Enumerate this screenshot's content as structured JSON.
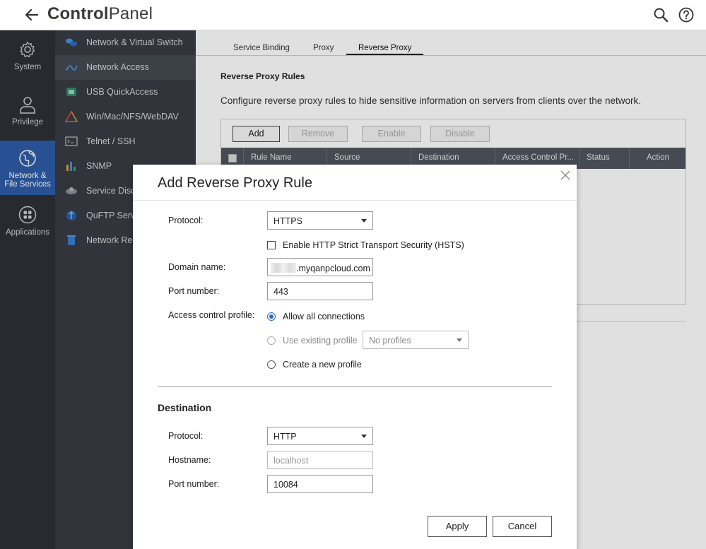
{
  "app": {
    "title_bold": "Control",
    "title_rest": "Panel"
  },
  "leftnav": [
    {
      "label": "System",
      "icon": "gear-icon"
    },
    {
      "label": "Privilege",
      "icon": "user-icon"
    },
    {
      "label": "Network & File Services",
      "icon": "globe-icon",
      "active": true
    },
    {
      "label": "Applications",
      "icon": "apps-grid-icon"
    }
  ],
  "submenu": [
    {
      "label": "Network & Virtual Switch",
      "icon": "network-switch-icon"
    },
    {
      "label": "Network Access",
      "icon": "network-access-icon",
      "active": true
    },
    {
      "label": "USB QuickAccess",
      "icon": "usb-icon"
    },
    {
      "label": "Win/Mac/NFS/WebDAV",
      "icon": "triangle-icon"
    },
    {
      "label": "Telnet / SSH",
      "icon": "terminal-icon"
    },
    {
      "label": "SNMP",
      "icon": "bar-chart-icon"
    },
    {
      "label": "Service Discovery",
      "icon": "satellite-icon"
    },
    {
      "label": "QuFTP Service",
      "icon": "ftp-icon"
    },
    {
      "label": "Network Recycle Bin",
      "icon": "recycle-bin-icon"
    }
  ],
  "tabs": [
    "Service Binding",
    "Proxy",
    "Reverse Proxy"
  ],
  "main": {
    "section_title": "Reverse Proxy Rules",
    "description": "Configure reverse proxy rules to hide sensitive information on servers from clients over the network.",
    "toolbar": {
      "add": "Add",
      "remove": "Remove",
      "enable": "Enable",
      "disable": "Disable"
    },
    "columns": [
      "Rule Name",
      "Source",
      "Destination",
      "Access Control Pr...",
      "Status",
      "Action"
    ]
  },
  "dialog": {
    "title": "Add Reverse Proxy Rule",
    "protocol_label": "Protocol:",
    "protocol_value": "HTTPS",
    "hsts_label": "Enable HTTP Strict Transport Security (HSTS)",
    "domain_label": "Domain name:",
    "domain_value": ".myqanpcloud.com",
    "port_label": "Port number:",
    "port_value": "443",
    "acl_label": "Access control profile:",
    "acl_options": [
      "Allow all connections",
      "Use existing profile",
      "Create a new profile"
    ],
    "profile_select": "No profiles",
    "destination_title": "Destination",
    "dest_protocol_label": "Protocol:",
    "dest_protocol_value": "HTTP",
    "hostname_label": "Hostname:",
    "hostname_placeholder": "localhost",
    "dest_port_label": "Port number:",
    "dest_port_value": "10084",
    "apply": "Apply",
    "cancel": "Cancel"
  },
  "colors": {
    "nav_bg": "#2d3036",
    "submenu_bg": "#383c43",
    "active_nav": "#2e5da8",
    "table_header": "#50565f",
    "radio_accent": "#2e6bc4"
  }
}
